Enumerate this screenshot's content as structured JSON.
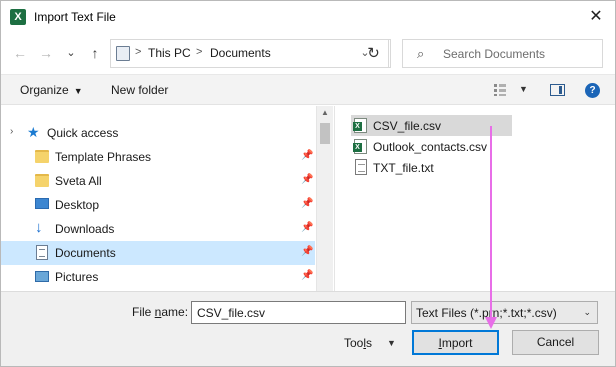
{
  "window": {
    "title": "Import Text File",
    "app_icon": "excel-icon",
    "close_glyph": "✕"
  },
  "navigation": {
    "back_glyph": "←",
    "forward_glyph": "→",
    "recent_glyph": "⌄",
    "up_glyph": "↑",
    "address": {
      "crumbs": [
        "This PC",
        "Documents"
      ],
      "separator": ">",
      "dropdown_glyph": "⌄"
    },
    "refresh_glyph": "↻",
    "search_placeholder": "Search Documents"
  },
  "toolbar": {
    "organize_label": "Organize",
    "new_folder_label": "New folder",
    "help_glyph": "?"
  },
  "sidebar": {
    "items": [
      {
        "label": "Quick access",
        "icon": "star-icon",
        "type": "group"
      },
      {
        "label": "Template Phrases",
        "icon": "folder-icon",
        "pinned": true
      },
      {
        "label": "Sveta All",
        "icon": "folder-icon",
        "pinned": true
      },
      {
        "label": "Desktop",
        "icon": "desktop-icon",
        "pinned": true
      },
      {
        "label": "Downloads",
        "icon": "download-icon",
        "pinned": true
      },
      {
        "label": "Documents",
        "icon": "documents-icon",
        "pinned": true,
        "selected": true
      },
      {
        "label": "Pictures",
        "icon": "pictures-icon",
        "pinned": true
      }
    ]
  },
  "files": [
    {
      "name": "CSV_file.csv",
      "icon": "csv-file-icon",
      "selected": true
    },
    {
      "name": "Outlook_contacts.csv",
      "icon": "csv-file-icon"
    },
    {
      "name": "TXT_file.txt",
      "icon": "text-file-icon"
    }
  ],
  "bottom": {
    "file_name_label_pre": "File ",
    "file_name_label_u": "n",
    "file_name_label_post": "ame:",
    "file_name_value": "CSV_file.csv",
    "file_type_value": "Text Files (*.prn;*.txt;*.csv)",
    "tools_pre": "Too",
    "tools_u": "l",
    "tools_post": "s",
    "import_u": "I",
    "import_post": "mport",
    "cancel_label": "Cancel"
  },
  "colors": {
    "accent": "#0078d7",
    "selection": "#cce8ff",
    "annotation_arrow": "#e86ee8",
    "excel_green": "#1d6f42"
  }
}
